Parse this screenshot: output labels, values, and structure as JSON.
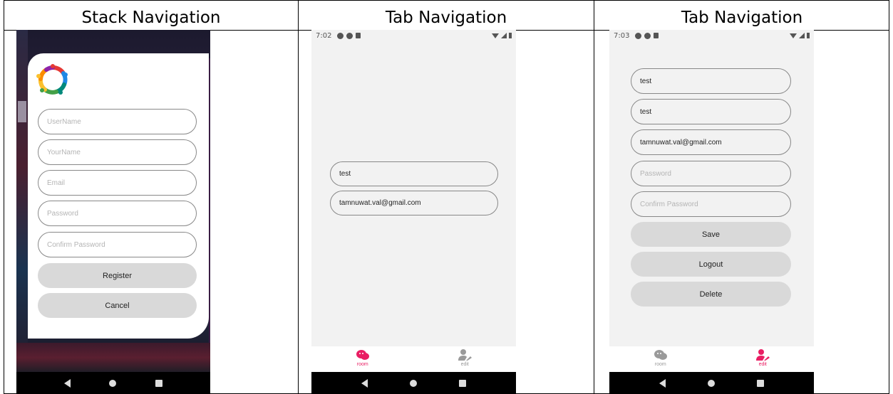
{
  "columns": [
    {
      "title": "Stack Navigation"
    },
    {
      "title": "Tab Navigation"
    },
    {
      "title": "Tab Navigation"
    }
  ],
  "colors": {
    "accent": "#e91e63",
    "inactive": "#9a9a9a",
    "button": "#d9d9d9",
    "screen": "#f2f2f2"
  },
  "stack": {
    "username_placeholder": "UserName",
    "yourname_placeholder": "YourName",
    "email_placeholder": "Email",
    "password_placeholder": "Password",
    "confirm_placeholder": "Confirm Password",
    "register_label": "Register",
    "cancel_label": "Cancel"
  },
  "room": {
    "time": "7:02",
    "name_value": "test",
    "email_value": "tamnuwat.val@gmail.com",
    "tab_room": "room",
    "tab_edit": "edit",
    "active_tab": "room"
  },
  "edit": {
    "time": "7:03",
    "username_value": "test",
    "name_value": "test",
    "email_value": "tamnuwat.val@gmail.com",
    "password_placeholder": "Password",
    "confirm_placeholder": "Confirm Password",
    "save_label": "Save",
    "logout_label": "Logout",
    "delete_label": "Delete",
    "tab_room": "room",
    "tab_edit": "edit",
    "active_tab": "edit"
  }
}
